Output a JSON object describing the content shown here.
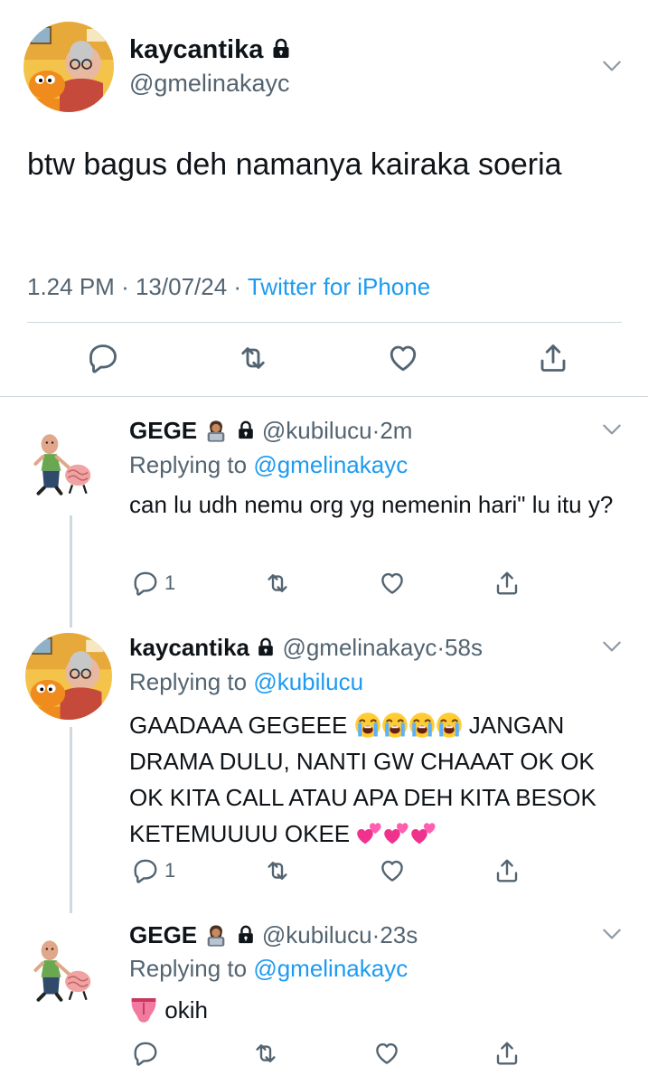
{
  "main": {
    "name": "kaycantika",
    "handle": "@gmelinakayc",
    "text": "btw bagus deh namanya kairaka soeria",
    "time": "1.24 PM",
    "date": "13/07/24",
    "source": "Twitter for iPhone",
    "sep": "·"
  },
  "replies": [
    {
      "name": "GEGE",
      "handle": "@kubilucu",
      "time": "2m",
      "replying_label": "Replying to",
      "replying_to": "@gmelinakayc",
      "text": "can lu udh nemu org yg nemenin hari\" lu itu y?",
      "reply_count": "1"
    },
    {
      "name": "kaycantika",
      "handle": "@gmelinakayc",
      "time": "58s",
      "replying_label": "Replying to",
      "replying_to": "@kubilucu",
      "text_a": "GAADAAA GEGEEE",
      "text_b": "JANGAN DRAMA DULU, NANTI GW CHAAAT OK OK OK KITA CALL ATAU APA DEH KITA BESOK KETEMUUUU OKEE",
      "reply_count": "1"
    },
    {
      "name": "GEGE",
      "handle": "@kubilucu",
      "time": "23s",
      "replying_label": "Replying to",
      "replying_to": "@gmelinakayc",
      "text": "okih",
      "reply_count": ""
    }
  ],
  "colors": {
    "link": "#1d9bf0",
    "muted": "#536471",
    "divider": "#cfd9de"
  },
  "icons": [
    "lock-icon",
    "chevron-down-icon",
    "reply-icon",
    "retweet-icon",
    "like-icon",
    "share-icon",
    "technologist-emoji",
    "loudly-crying-emoji",
    "two-hearts-emoji",
    "tongue-emoji"
  ]
}
